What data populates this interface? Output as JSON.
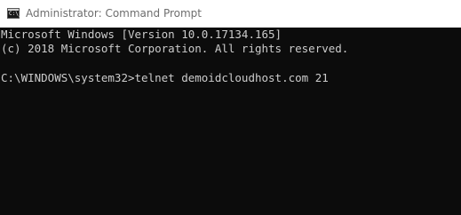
{
  "window": {
    "title": "Administrator: Command Prompt",
    "icon": "cmd-prompt-icon",
    "icon_glyph": "C:\\_"
  },
  "console": {
    "lines": [
      "Microsoft Windows [Version 10.0.17134.165]",
      "(c) 2018 Microsoft Corporation. All rights reserved.",
      "C:\\WINDOWS\\system32>telnet demoidcloudhost.com 21"
    ]
  },
  "colors": {
    "console_background": "#0c0c0c",
    "console_text": "#cccccc",
    "titlebar_background": "#ffffff",
    "title_text": "#6e6e6e"
  }
}
